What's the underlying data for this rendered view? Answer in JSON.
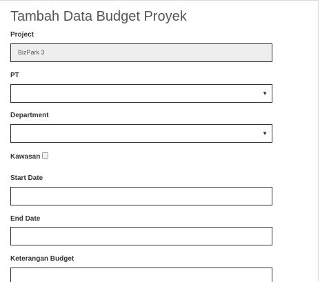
{
  "title": "Tambah Data Budget Proyek",
  "form": {
    "project": {
      "label": "Project",
      "value": "BizPark 3"
    },
    "pt": {
      "label": "PT",
      "value": ""
    },
    "department": {
      "label": "Department",
      "value": ""
    },
    "kawasan": {
      "label": "Kawasan",
      "checked": false
    },
    "start_date": {
      "label": "Start Date",
      "value": ""
    },
    "end_date": {
      "label": "End Date",
      "value": ""
    },
    "keterangan_budget": {
      "label": "Keterangan Budget",
      "value": ""
    }
  },
  "icons": {
    "dropdown": "▼"
  }
}
